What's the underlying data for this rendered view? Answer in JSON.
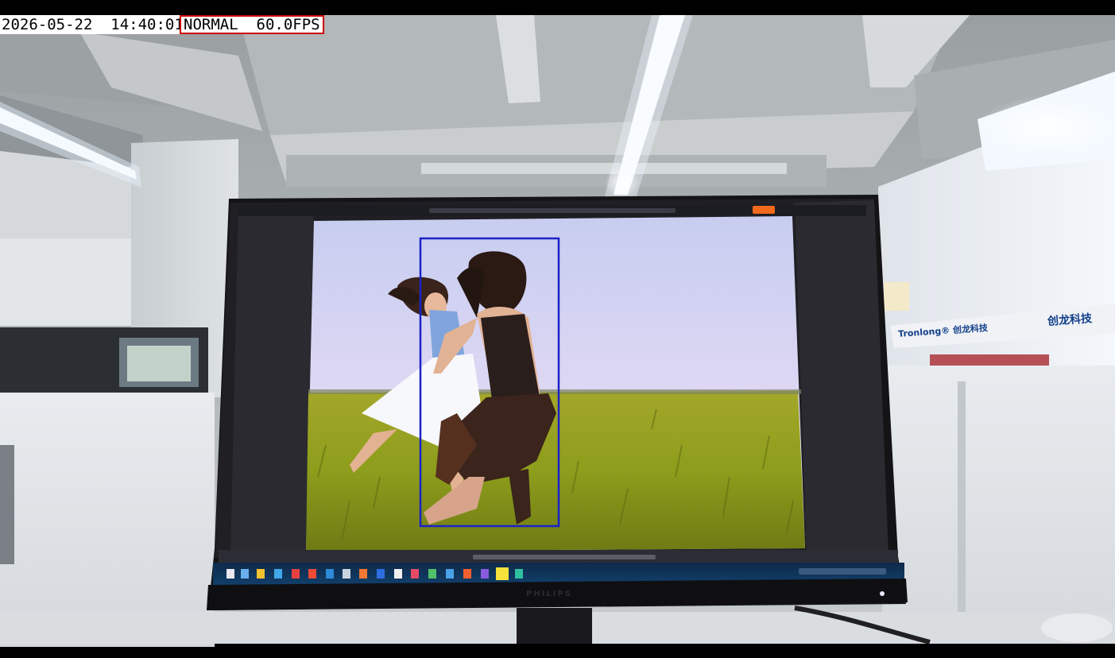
{
  "overlay": {
    "timestamp": "2026-05-22  14:40:01",
    "mode_label": "NORMAL  60.0FPS",
    "mode_border_color": "#cc0000"
  },
  "detection": {
    "box_color": "#1a22c8",
    "count": 1
  },
  "scene": {
    "wall_sign_brand": "创龙科技",
    "wall_sign_text": "Tronlong® 创龙科技",
    "monitor_brand": "PHILIPS"
  },
  "colors": {
    "sky": "#cfd6f2",
    "field": "#9aa623",
    "monitor_bezel": "#141417",
    "ceiling": "#bfc3c4"
  }
}
